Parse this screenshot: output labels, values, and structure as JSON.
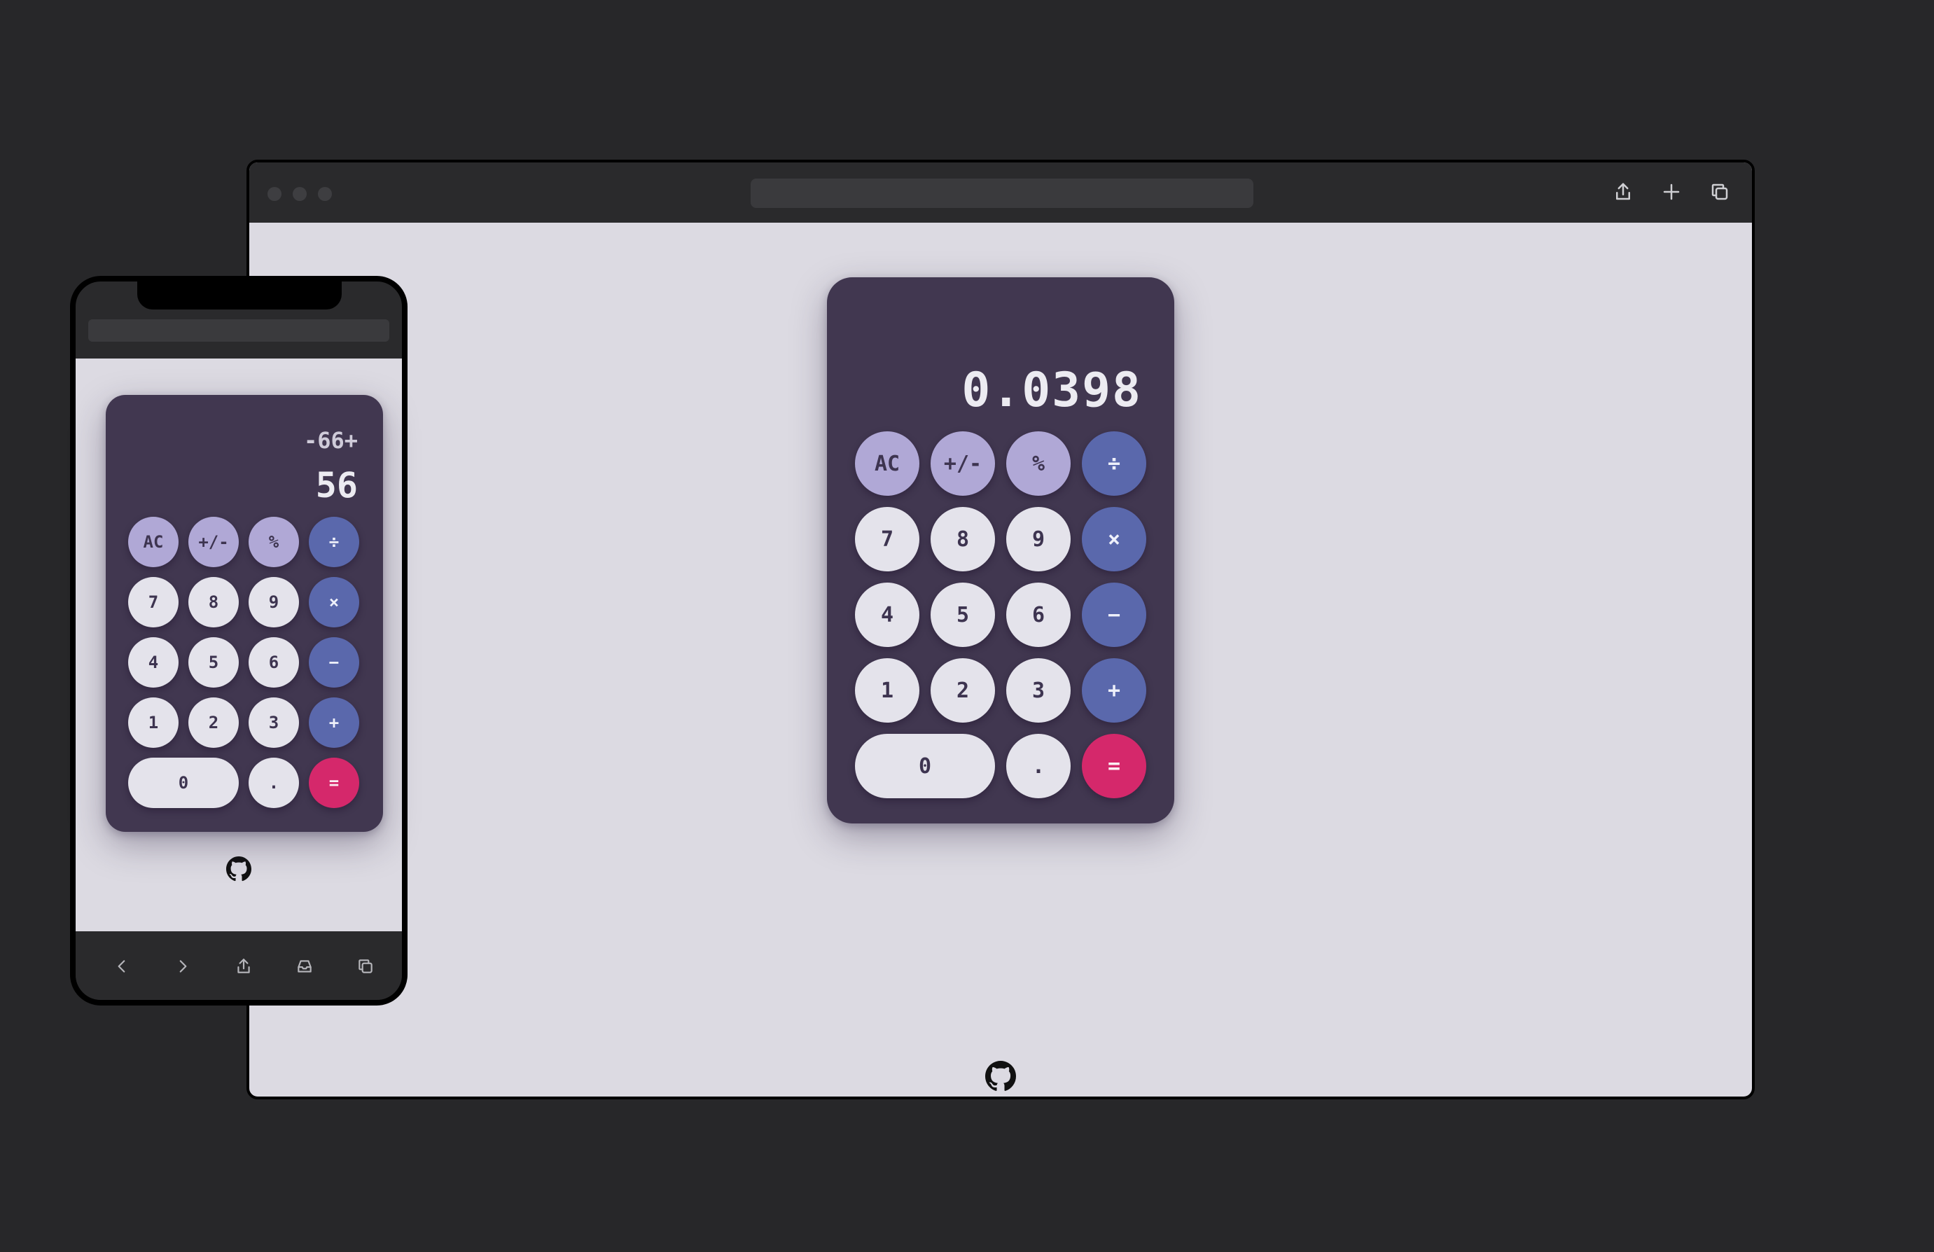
{
  "colors": {
    "background": "#272729",
    "page": "#dcdae2",
    "calculator_body": "#413750",
    "function_key": "#b0a8d6",
    "number_key": "#e4e3eb",
    "operator_key": "#5a68ac",
    "equals_key": "#d5286b"
  },
  "desktop": {
    "toolbar_icons": [
      "share-icon",
      "plus-icon",
      "tabs-icon"
    ],
    "calculator": {
      "previous": "",
      "current": "0.0398",
      "keys": {
        "ac": "AC",
        "sign": "+/-",
        "percent": "%",
        "divide": "÷",
        "seven": "7",
        "eight": "8",
        "nine": "9",
        "multiply": "×",
        "four": "4",
        "five": "5",
        "six": "6",
        "minus": "−",
        "one": "1",
        "two": "2",
        "three": "3",
        "plus": "+",
        "zero": "0",
        "dot": ".",
        "equals": "="
      }
    }
  },
  "phone": {
    "toolbar_icons": [
      "back-icon",
      "forward-icon",
      "share-icon",
      "inbox-icon",
      "tabs-icon"
    ],
    "calculator": {
      "previous": "-66+",
      "current": "56",
      "keys": {
        "ac": "AC",
        "sign": "+/-",
        "percent": "%",
        "divide": "÷",
        "seven": "7",
        "eight": "8",
        "nine": "9",
        "multiply": "×",
        "four": "4",
        "five": "5",
        "six": "6",
        "minus": "−",
        "one": "1",
        "two": "2",
        "three": "3",
        "plus": "+",
        "zero": "0",
        "dot": ".",
        "equals": "="
      }
    }
  }
}
